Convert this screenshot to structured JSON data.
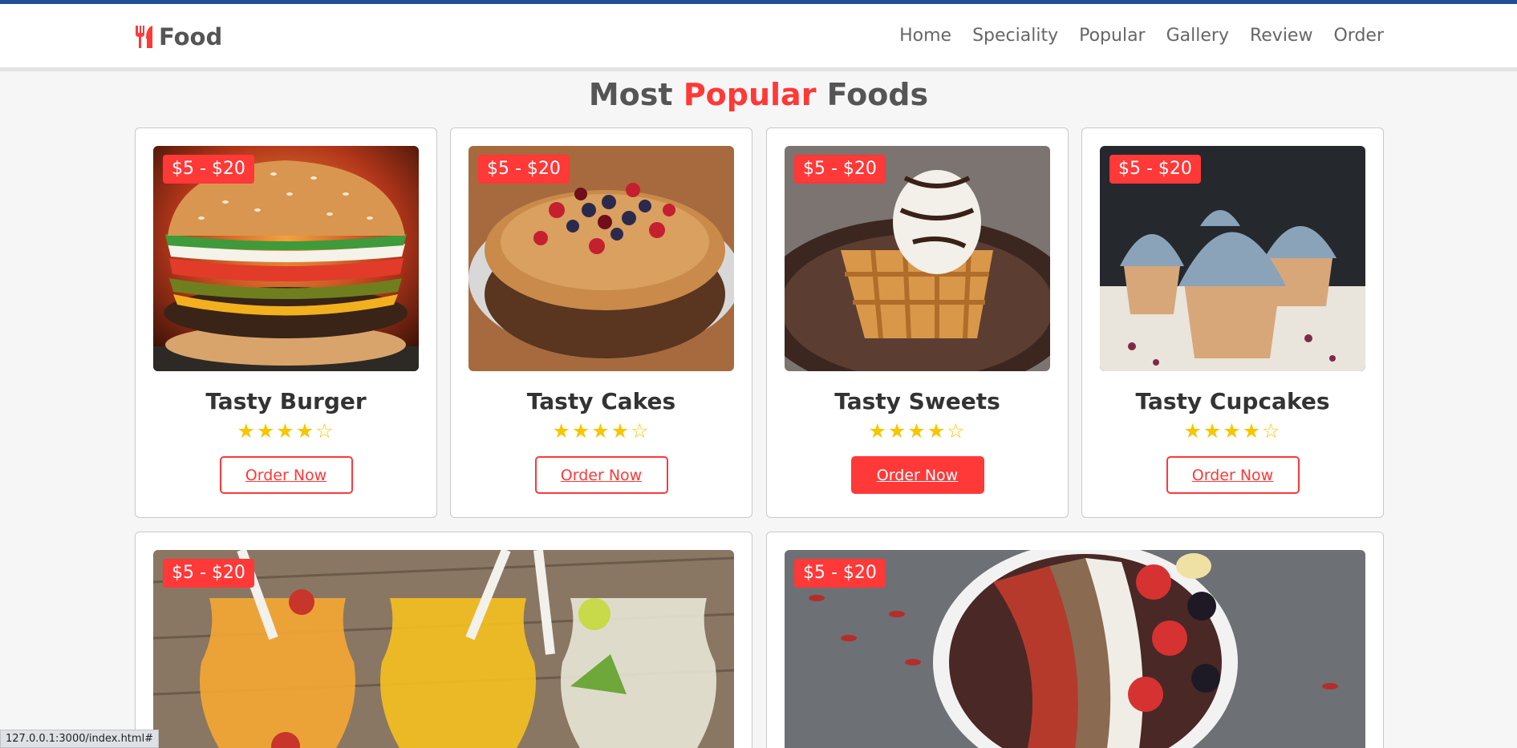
{
  "logo": {
    "icon": "utensils-icon",
    "text": "Food"
  },
  "nav": [
    "Home",
    "Speciality",
    "Popular",
    "Gallery",
    "Review",
    "Order"
  ],
  "heading": {
    "part1": "Most",
    "accent": "Popular",
    "part2": "Foods"
  },
  "colors": {
    "accent": "#ff3838",
    "star": "#f6c600",
    "topbar": "#1f4f93"
  },
  "cards": [
    {
      "price": "$5 - $20",
      "title": "Tasty Burger",
      "rating": 4,
      "button": "Order Now",
      "image": "burger"
    },
    {
      "price": "$5 - $20",
      "title": "Tasty Cakes",
      "rating": 4,
      "button": "Order Now",
      "image": "cake"
    },
    {
      "price": "$5 - $20",
      "title": "Tasty Sweets",
      "rating": 4,
      "button": "Order Now",
      "image": "waffle-ice-cream"
    },
    {
      "price": "$5 - $20",
      "title": "Tasty Cupcakes",
      "rating": 4,
      "button": "Order Now",
      "image": "cupcakes"
    },
    {
      "price": "$5 - $20",
      "image": "drinks"
    },
    {
      "price": "$5 - $20",
      "image": "fruit-bowl"
    }
  ],
  "status_url": "127.0.0.1:3000/index.html#"
}
